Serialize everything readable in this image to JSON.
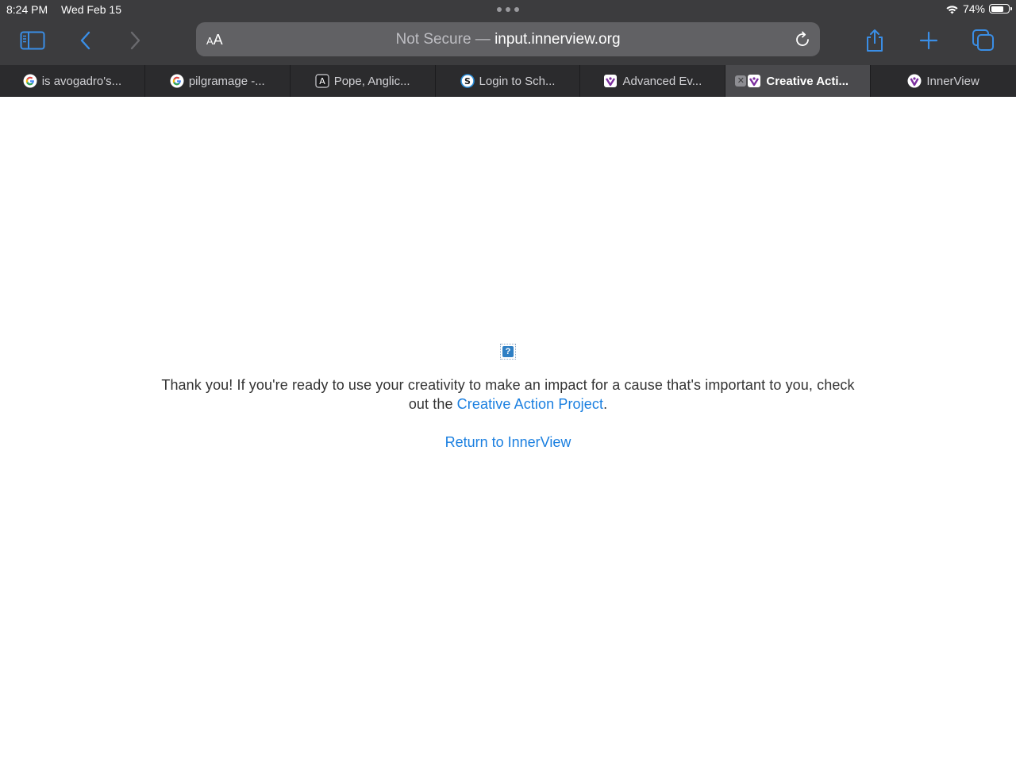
{
  "status_bar": {
    "time": "8:24 PM",
    "date": "Wed Feb 15",
    "battery_percent": "74%",
    "battery_level": 0.74
  },
  "toolbar": {
    "text_size_label_small": "A",
    "text_size_label_large": "A",
    "url_security": "Not Secure —",
    "url_domain": "input.innerview.org"
  },
  "tabs": [
    {
      "title": "is avogadro's...",
      "icon": "google-icon",
      "active": false
    },
    {
      "title": "pilgramage -...",
      "icon": "google-icon",
      "active": false
    },
    {
      "title": "Pope, Anglic...",
      "icon": "a-letter-icon",
      "active": false
    },
    {
      "title": "Login to Sch...",
      "icon": "schoology-icon",
      "active": false
    },
    {
      "title": "Advanced Ev...",
      "icon": "innerview-icon",
      "active": false
    },
    {
      "title": "Creative Acti...",
      "icon": "innerview-icon",
      "active": true
    },
    {
      "title": "InnerView",
      "icon": "innerview-icon",
      "active": false
    }
  ],
  "content": {
    "broken_image_icon": "question-mark-icon",
    "message_text": "Thank you! If you're ready to use your creativity to make an impact for a cause that's important to you, check out the",
    "message_link": "Creative Action Project",
    "message_end": ".",
    "return_link": "Return to InnerView"
  },
  "colors": {
    "chrome": "#3c3c3e",
    "tab_bar": "#2b2b2d",
    "accent": "#3a8ee6",
    "link": "#1a7fe0",
    "innerview_purple": "#7b2f9e"
  }
}
